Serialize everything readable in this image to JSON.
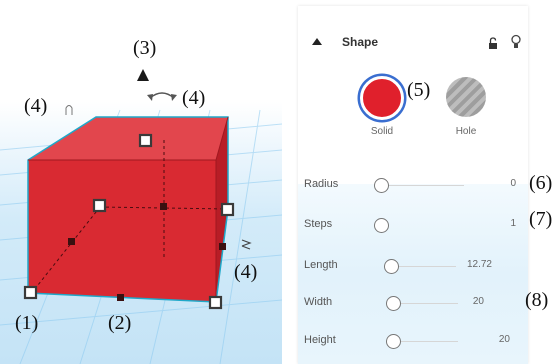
{
  "viewport": {
    "callouts": {
      "c1": "(1)",
      "c2": "(2)",
      "c3": "(3)",
      "c4_left": "(4)",
      "c4_top": "(4)",
      "c4_right": "(4)"
    },
    "shape_color": "#d92a32",
    "workplane_color": "#8ccaf0"
  },
  "panel": {
    "title": "Shape",
    "solid_label": "Solid",
    "hole_label": "Hole",
    "solid_color": "#e0202c",
    "callout_solid": "(5)",
    "params": [
      {
        "label": "Radius",
        "value": "0",
        "callout": "(6)"
      },
      {
        "label": "Steps",
        "value": "1",
        "callout": "(7)"
      },
      {
        "label": "Length",
        "value": "12.72",
        "callout": ""
      },
      {
        "label": "Width",
        "value": "20",
        "callout": "(8)"
      },
      {
        "label": "Height",
        "value": "20",
        "callout": ""
      }
    ]
  }
}
